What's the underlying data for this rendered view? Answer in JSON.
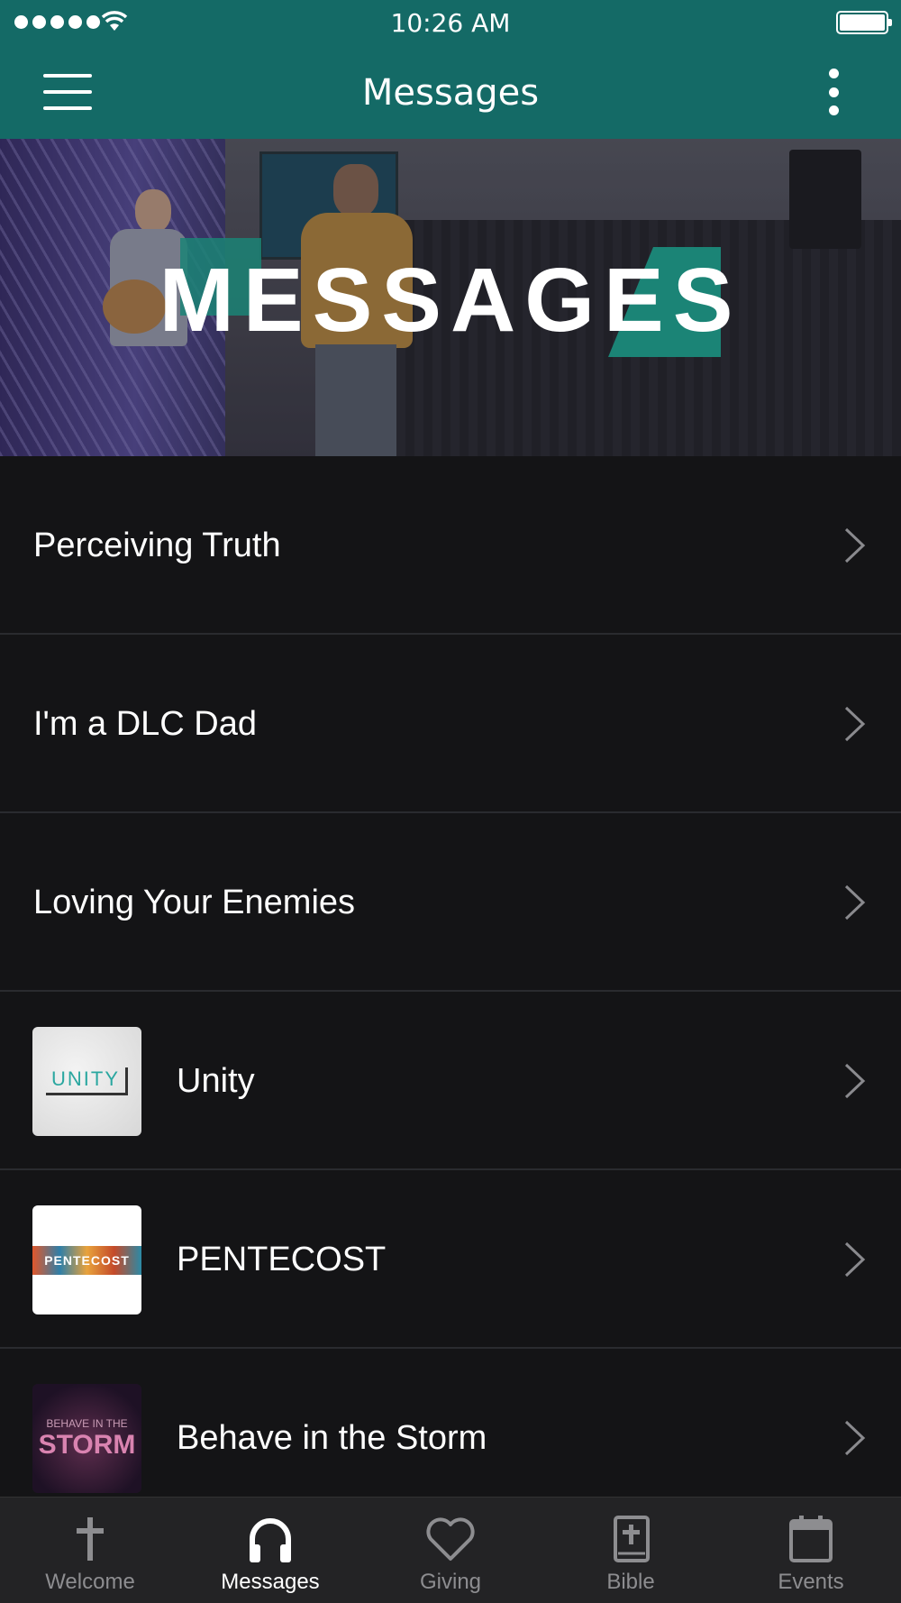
{
  "status_bar": {
    "time": "10:26 AM"
  },
  "nav": {
    "title": "Messages"
  },
  "hero": {
    "title": "MESSAGES"
  },
  "messages": [
    {
      "title": "Perceiving Truth"
    },
    {
      "title": "I'm a DLC Dad"
    },
    {
      "title": "Loving Your Enemies"
    },
    {
      "title": "Unity",
      "thumb_text": "UNITY"
    },
    {
      "title": "PENTECOST",
      "thumb_text": "PENTECOST"
    },
    {
      "title": "Behave in the Storm",
      "thumb_text_top": "BEHAVE IN THE",
      "thumb_text_bottom": "STORM"
    }
  ],
  "tabs": [
    {
      "label": "Welcome",
      "icon": "cross-icon",
      "active": false
    },
    {
      "label": "Messages",
      "icon": "headphones-icon",
      "active": true
    },
    {
      "label": "Giving",
      "icon": "heart-icon",
      "active": false
    },
    {
      "label": "Bible",
      "icon": "bible-icon",
      "active": false
    },
    {
      "label": "Events",
      "icon": "calendar-icon",
      "active": false
    }
  ],
  "colors": {
    "brand": "#146a66",
    "accent": "#1b8476",
    "background": "#141416",
    "tab_bar": "#232325",
    "inactive": "#8d8d90"
  }
}
